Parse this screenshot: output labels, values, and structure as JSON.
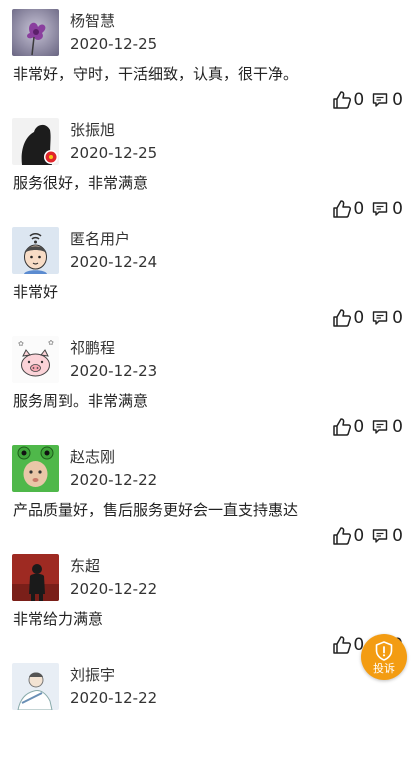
{
  "reviews": [
    {
      "name": "杨智慧",
      "date": "2020-12-25",
      "comment": "非常好，守时，干活细致，认真，很干净。",
      "likes": "0",
      "comments": "0",
      "avatar_icon": "purple-flower-avatar"
    },
    {
      "name": "张振旭",
      "date": "2020-12-25",
      "comment": "服务很好，非常满意",
      "likes": "0",
      "comments": "0",
      "avatar_icon": "dark-figure-avatar"
    },
    {
      "name": "匿名用户",
      "date": "2020-12-24",
      "comment": "非常好",
      "likes": "0",
      "comments": "0",
      "avatar_icon": "cartoon-boy-avatar"
    },
    {
      "name": "祁鹏程",
      "date": "2020-12-23",
      "comment": "服务周到。非常满意",
      "likes": "0",
      "comments": "0",
      "avatar_icon": "pig-avatar"
    },
    {
      "name": "赵志刚",
      "date": "2020-12-22",
      "comment": "产品质量好，售后服务更好会一直支持惠达",
      "likes": "0",
      "comments": "0",
      "avatar_icon": "frog-hat-baby-avatar"
    },
    {
      "name": "东超",
      "date": "2020-12-22",
      "comment": "非常给力满意",
      "likes": "0",
      "comments": "0",
      "avatar_icon": "red-figure-avatar"
    },
    {
      "name": "刘振宇",
      "date": "2020-12-22",
      "comment": "",
      "likes": "",
      "comments": "",
      "avatar_icon": "sketch-person-avatar"
    }
  ],
  "complain_button": {
    "label": "投诉",
    "icon": "shield-alert-icon",
    "color": "#f39c12"
  }
}
